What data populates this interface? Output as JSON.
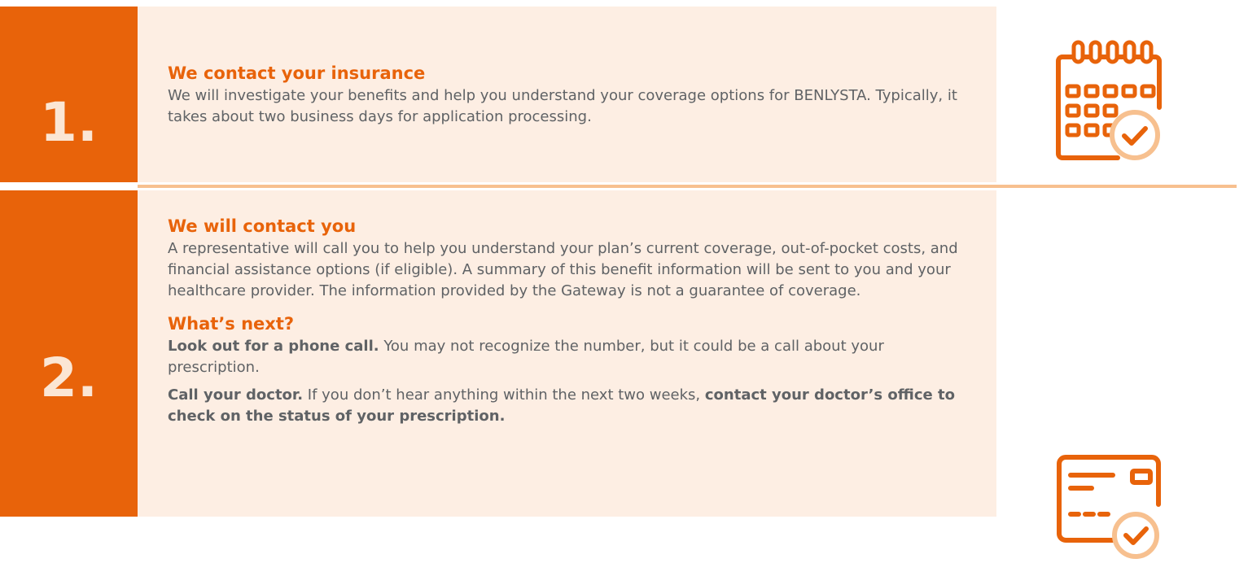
{
  "steps": [
    {
      "number": "1.",
      "heading": "We contact your insurance",
      "body": "We will investigate your benefits and help you understand your coverage options for BENLYSTA. Typically, it takes about two business days for application processing.",
      "icon": "calendar-check-icon"
    },
    {
      "number": "2.",
      "heading": "We will contact you",
      "body": "A representative will call you to help you understand your plan’s current coverage, out-of-pocket costs, and financial assistance options (if eligible). A summary of this benefit information will be sent to you and your healthcare provider. The information provided by the Gateway is not a guarantee of coverage.",
      "subheading": "What’s next?",
      "next_items": [
        {
          "lead": "Look out for a phone call.",
          "text": " You may not recognize the number, but it could be a call about your prescription."
        },
        {
          "lead": "Call your doctor.",
          "text": " If you don’t hear anything within the next two weeks, ",
          "emphasis": "contact your doctor’s office to check on the status of your prescription."
        }
      ],
      "icon": "card-check-icon"
    }
  ],
  "colors": {
    "accent": "#e8630a",
    "panel": "#fdeee3",
    "divider": "#f7c08f",
    "text": "#5f6265",
    "number_text": "#fbe6d4"
  }
}
